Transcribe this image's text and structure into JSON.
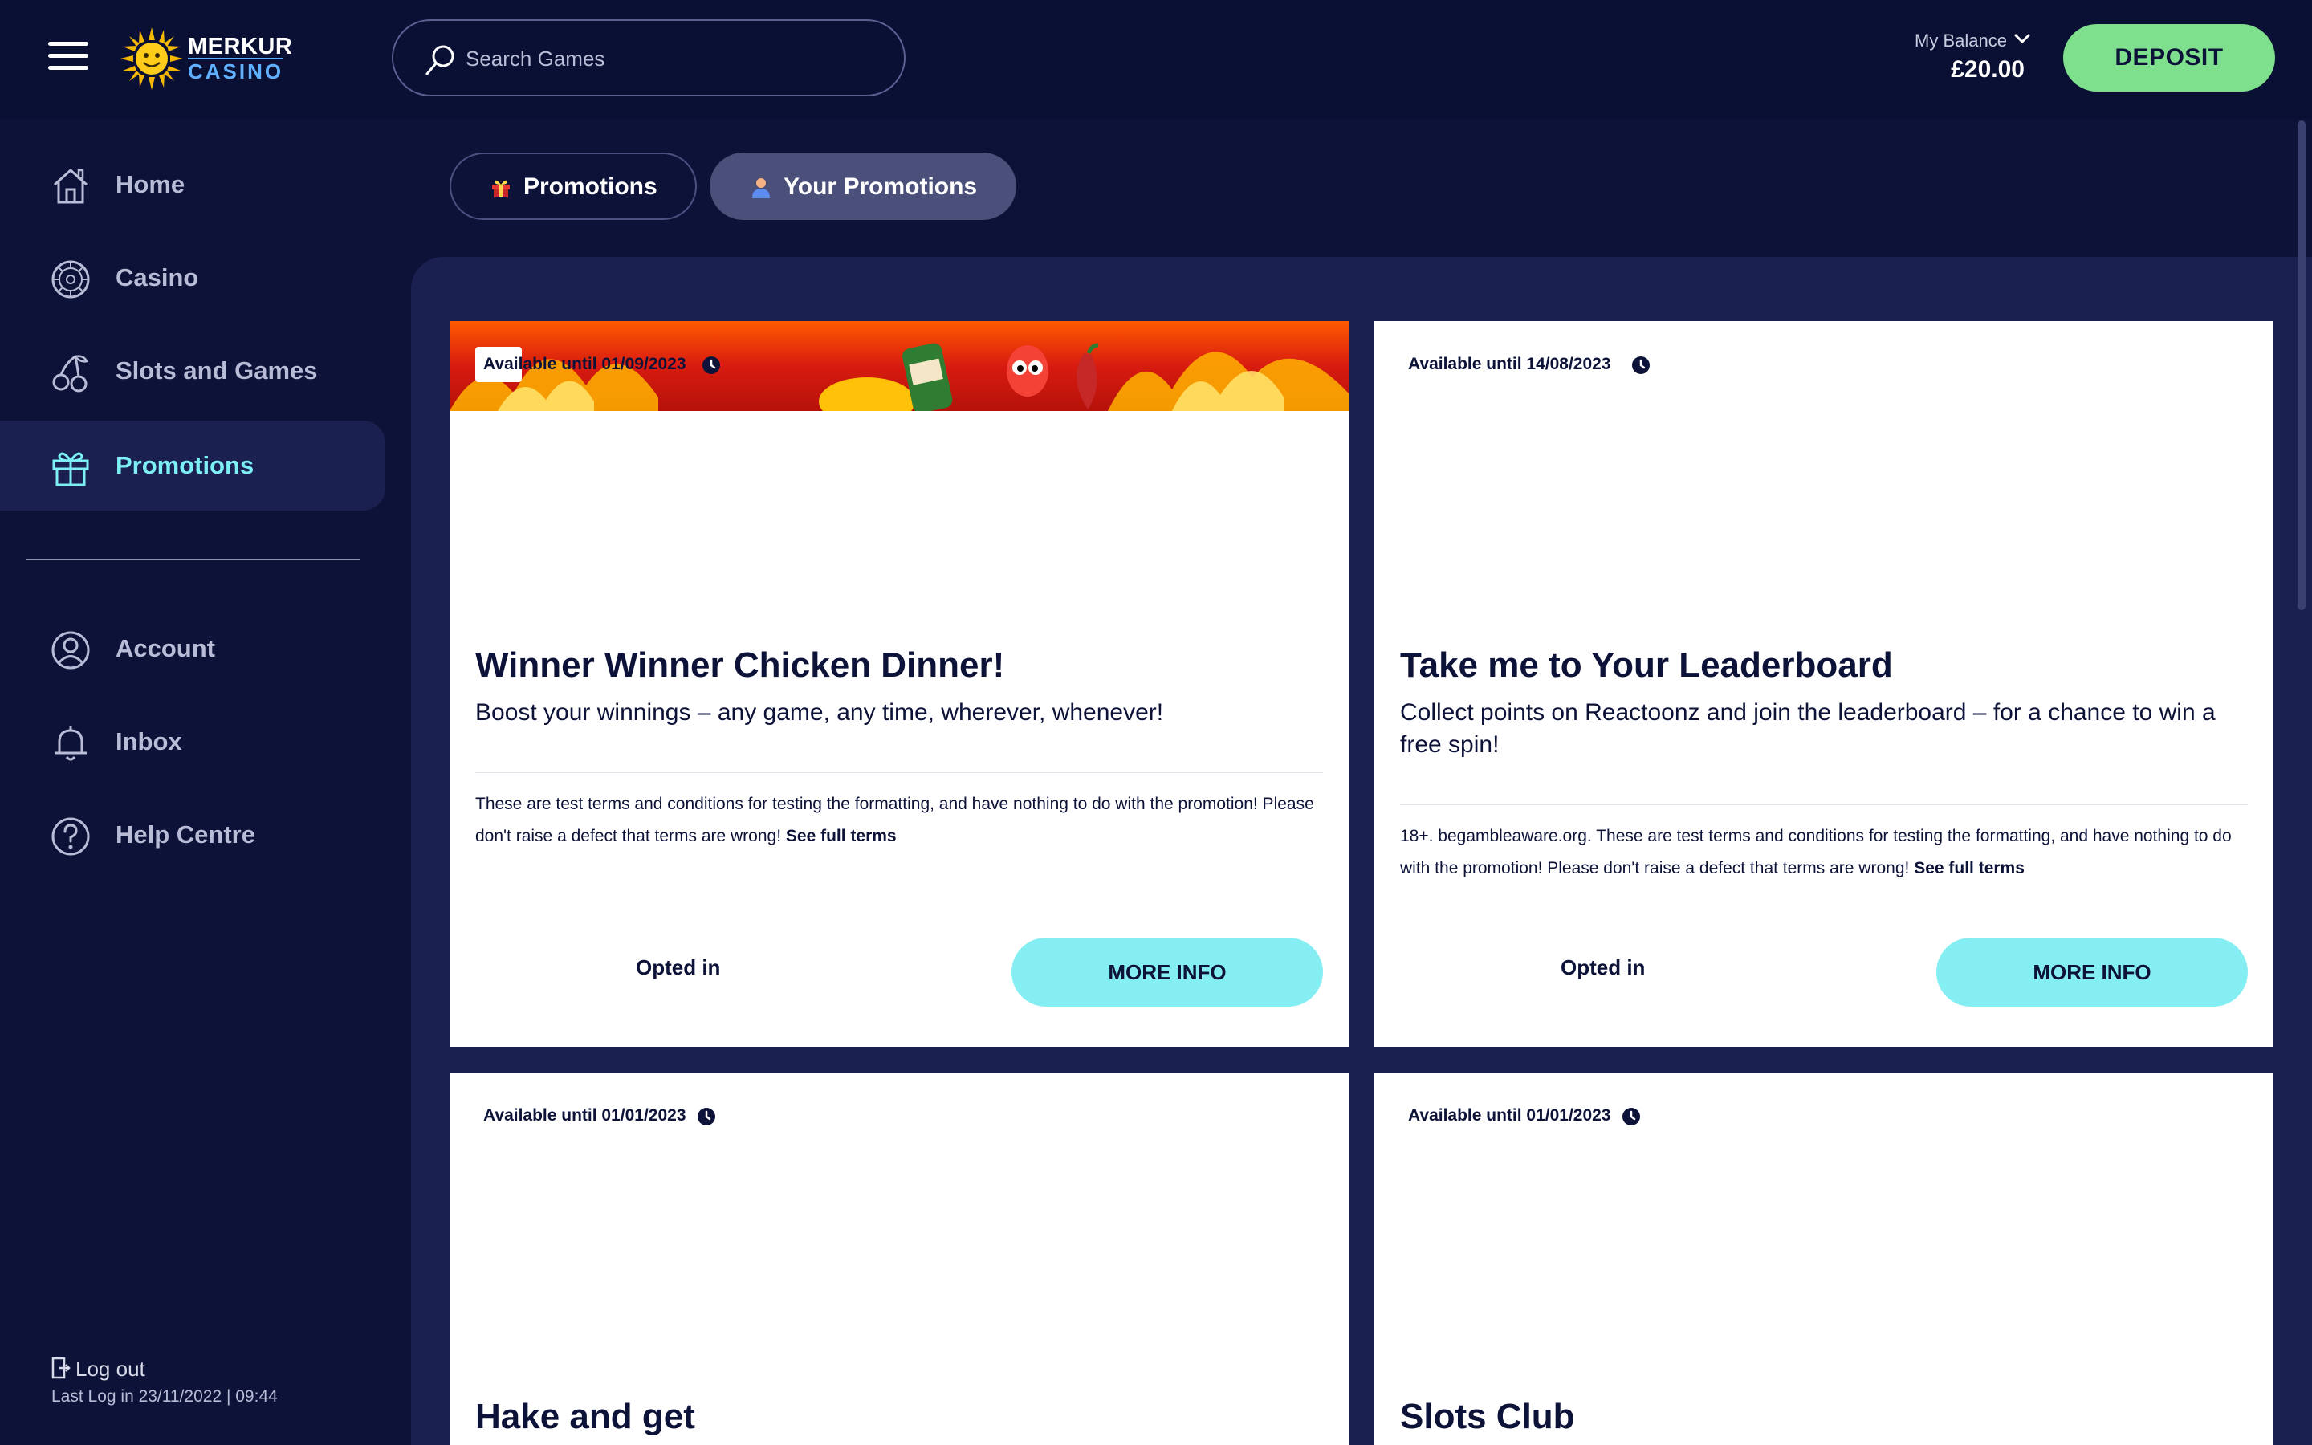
{
  "header": {
    "logo_line1": "MERKUR",
    "logo_line2": "CASINO",
    "search_placeholder": "Search Games",
    "balance_label": "My Balance",
    "balance_value": "£20.00",
    "deposit_label": "DEPOSIT"
  },
  "sidebar": {
    "items": [
      {
        "label": "Home",
        "icon": "home-icon"
      },
      {
        "label": "Casino",
        "icon": "roulette-icon"
      },
      {
        "label": "Slots and Games",
        "icon": "cherries-icon"
      },
      {
        "label": "Promotions",
        "icon": "gift-icon",
        "active": true
      },
      {
        "label": "Account",
        "icon": "user-icon"
      },
      {
        "label": "Inbox",
        "icon": "bell-icon"
      },
      {
        "label": "Help Centre",
        "icon": "question-icon"
      }
    ],
    "logout_label": "Log out",
    "last_log": "Last Log in 23/11/2022 | 09:44"
  },
  "tabs": [
    {
      "label": "Promotions",
      "icon": "gift-icon",
      "active": false
    },
    {
      "label": "Your Promotions",
      "icon": "person-icon",
      "active": true
    }
  ],
  "cards": [
    {
      "available": "Available until 01/09/2023",
      "title": "Winner Winner Chicken Dinner!",
      "subtitle": "Boost your winnings – any game, any time, wherever, whenever!",
      "terms": "These are test terms and conditions for testing the formatting, and have nothing to do with the promotion! Please don't raise a defect that terms are wrong!",
      "terms_link": "See full terms",
      "status": "Opted in",
      "button": "MORE INFO"
    },
    {
      "available": "Available until 14/08/2023",
      "title": "Take me to Your Leaderboard",
      "subtitle": "Collect points on Reactoonz and join the leaderboard – for a chance to win a free spin!",
      "terms": "18+. begambleaware.org. These are test terms and conditions for testing the formatting, and have nothing to do with the promotion! Please don't raise a defect that terms are wrong!",
      "terms_link": "See full terms",
      "status": "Opted in",
      "button": "MORE INFO"
    },
    {
      "available": "Available until 01/01/2023",
      "title": "Hake and get"
    },
    {
      "available": "Available until 01/01/2023",
      "title": "Slots Club"
    }
  ],
  "colors": {
    "background": "#0d1238",
    "panel": "#1a2150",
    "accent_cyan": "#84eef2",
    "deposit_green": "#7ee08c",
    "active_nav_text": "#7df0f5"
  }
}
